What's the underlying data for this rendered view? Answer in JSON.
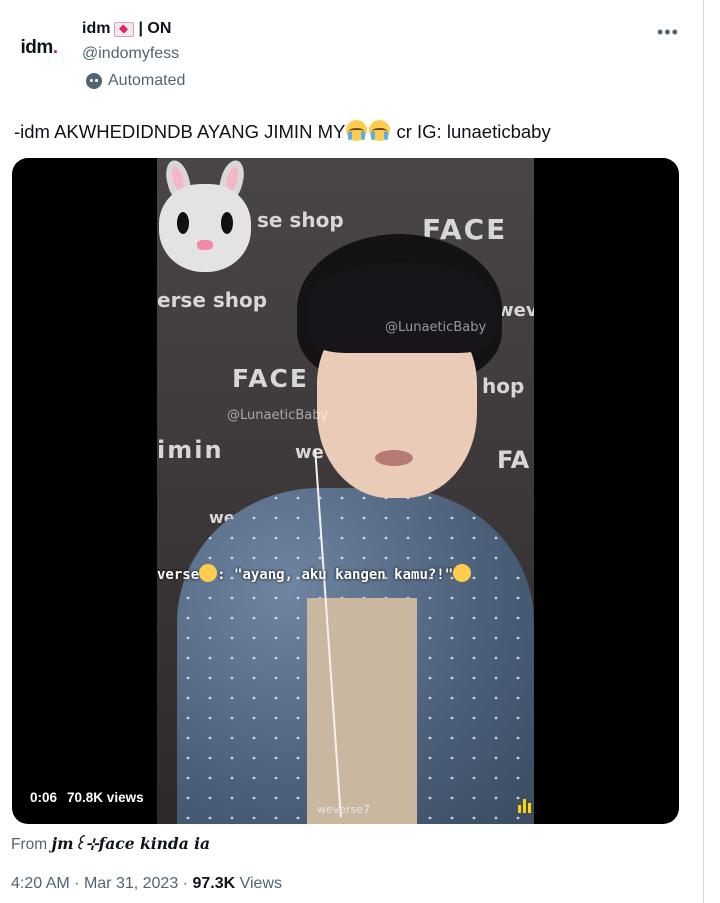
{
  "account": {
    "avatar_text": "idm",
    "avatar_dot": ".",
    "display_name": "idm",
    "name_suffix": "| ON",
    "handle": "@indomyfess",
    "automated_label": "Automated",
    "icons": [
      "envelope-heart-icon",
      "bot-icon",
      "more-options-icon"
    ]
  },
  "tweet": {
    "text_before_emoji": "-idm AKWHEDIDNDB AYANG JIMIN MY",
    "emojis": [
      "crying-face-emoji",
      "crying-face-emoji"
    ],
    "text_after_emoji": "cr IG: lunaeticbaby"
  },
  "media": {
    "backdrop_words": [
      "se shop",
      "FACE",
      "erse shop",
      "weve",
      "FACE",
      "hop",
      "imin",
      "we",
      "FA",
      "wever"
    ],
    "watermark": "@LunaeticBaby",
    "caption": ": \"ayang, aku kangen kamu?!\"",
    "caption_left_prefix": "verse",
    "footer_text": "weverse7",
    "duration": "0:06",
    "views": "70.8K views"
  },
  "source": {
    "from_label": "From",
    "source_name": "𝒋𝒎꒰⊹𝒇𝒂𝒄𝒆 kinda ia"
  },
  "meta": {
    "time": "4:20 AM",
    "separator": "·",
    "date": "Mar 31, 2023",
    "view_count": "97.3K",
    "views_label": "Views"
  }
}
